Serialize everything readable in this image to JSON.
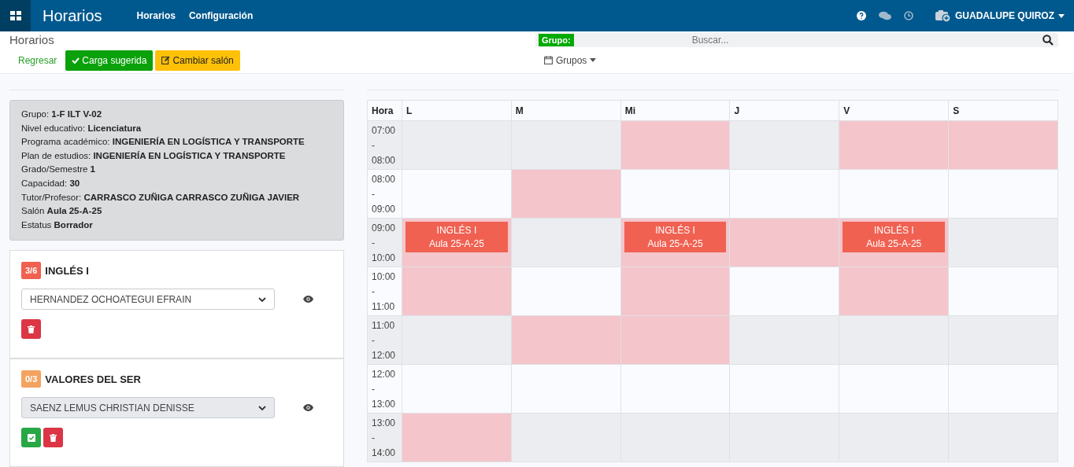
{
  "navbar": {
    "app_title": "Horarios",
    "links": [
      {
        "label": "Horarios"
      },
      {
        "label": "Configuración"
      }
    ],
    "user": "GUADALUPE QUIROZ"
  },
  "page": {
    "heading": "Horarios",
    "search": {
      "badge": "Grupo:",
      "placeholder": "Buscar..."
    }
  },
  "toolbar": {
    "back": "Regresar",
    "buttons": [
      {
        "kind": "success",
        "label": "Carga sugerida"
      },
      {
        "kind": "warning",
        "label": "Cambiar salón"
      }
    ],
    "dropdown": "Grupos"
  },
  "group_info": [
    {
      "label": "Grupo:",
      "value": "1-F ILT V-02"
    },
    {
      "label": "Nivel educativo:",
      "value": "Licenciatura"
    },
    {
      "label": "Programa académico:",
      "value": "INGENIERÍA EN LOGÍSTICA Y TRANSPORTE"
    },
    {
      "label": "Plan de estudios:",
      "value": "INGENIERÍA EN LOGÍSTICA Y TRANSPORTE"
    },
    {
      "label": "Grado/Semestre",
      "value": "1"
    },
    {
      "label": "Capacidad:",
      "value": "30"
    },
    {
      "label": "Tutor/Profesor:",
      "value": "CARRASCO ZUÑIGA CARRASCO ZUÑIGA JAVIER"
    },
    {
      "label": "Salón",
      "value": "Aula 25-A-25"
    },
    {
      "label": "Estatus",
      "value": "Borrador"
    }
  ],
  "subjects": [
    {
      "count": "3/6",
      "color": "#f0614f",
      "name": "INGLÉS I",
      "teacher": "HERNANDEZ OCHOATEGUI EFRAIN",
      "disabled": false,
      "confirm": false
    },
    {
      "count": "0/3",
      "color": "#f3a360",
      "name": "VALORES DEL SER",
      "teacher": "SAENZ LEMUS CHRISTIAN DENISSE",
      "disabled": true,
      "confirm": true
    }
  ],
  "schedule": {
    "time_header": "Hora",
    "days": [
      "L",
      "M",
      "Mi",
      "J",
      "V",
      "S"
    ],
    "rows": [
      {
        "time": [
          "07:00",
          "-",
          "08:00"
        ],
        "cells": [
          {
            "blocked": false
          },
          {
            "blocked": false
          },
          {
            "blocked": true
          },
          {
            "blocked": false
          },
          {
            "blocked": true
          },
          {
            "blocked": true
          }
        ]
      },
      {
        "time": [
          "08:00",
          "-",
          "09:00"
        ],
        "cells": [
          {
            "blocked": false
          },
          {
            "blocked": true
          },
          {
            "blocked": false
          },
          {
            "blocked": false
          },
          {
            "blocked": false
          },
          {
            "blocked": false
          }
        ]
      },
      {
        "time": [
          "09:00",
          "-",
          "10:00"
        ],
        "cells": [
          {
            "blocked": true,
            "event": {
              "title": "INGLÉS I",
              "room": "Aula 25-A-25"
            }
          },
          {
            "blocked": false
          },
          {
            "blocked": true,
            "event": {
              "title": "INGLÉS I",
              "room": "Aula 25-A-25"
            }
          },
          {
            "blocked": true
          },
          {
            "blocked": true,
            "event": {
              "title": "INGLÉS I",
              "room": "Aula 25-A-25"
            }
          },
          {
            "blocked": false
          }
        ]
      },
      {
        "time": [
          "10:00",
          "-",
          "11:00"
        ],
        "cells": [
          {
            "blocked": true
          },
          {
            "blocked": false
          },
          {
            "blocked": true
          },
          {
            "blocked": false
          },
          {
            "blocked": true
          },
          {
            "blocked": false
          }
        ]
      },
      {
        "time": [
          "11:00",
          "-",
          "12:00"
        ],
        "cells": [
          {
            "blocked": false
          },
          {
            "blocked": true
          },
          {
            "blocked": true
          },
          {
            "blocked": false
          },
          {
            "blocked": false
          },
          {
            "blocked": false
          }
        ]
      },
      {
        "time": [
          "12:00",
          "-",
          "13:00"
        ],
        "cells": [
          {
            "blocked": false
          },
          {
            "blocked": false
          },
          {
            "blocked": false
          },
          {
            "blocked": false
          },
          {
            "blocked": false
          },
          {
            "blocked": false
          }
        ]
      },
      {
        "time": [
          "13:00",
          "-",
          "14:00"
        ],
        "cells": [
          {
            "blocked": true
          },
          {
            "blocked": false
          },
          {
            "blocked": false
          },
          {
            "blocked": false
          },
          {
            "blocked": false
          },
          {
            "blocked": false
          }
        ]
      }
    ]
  }
}
